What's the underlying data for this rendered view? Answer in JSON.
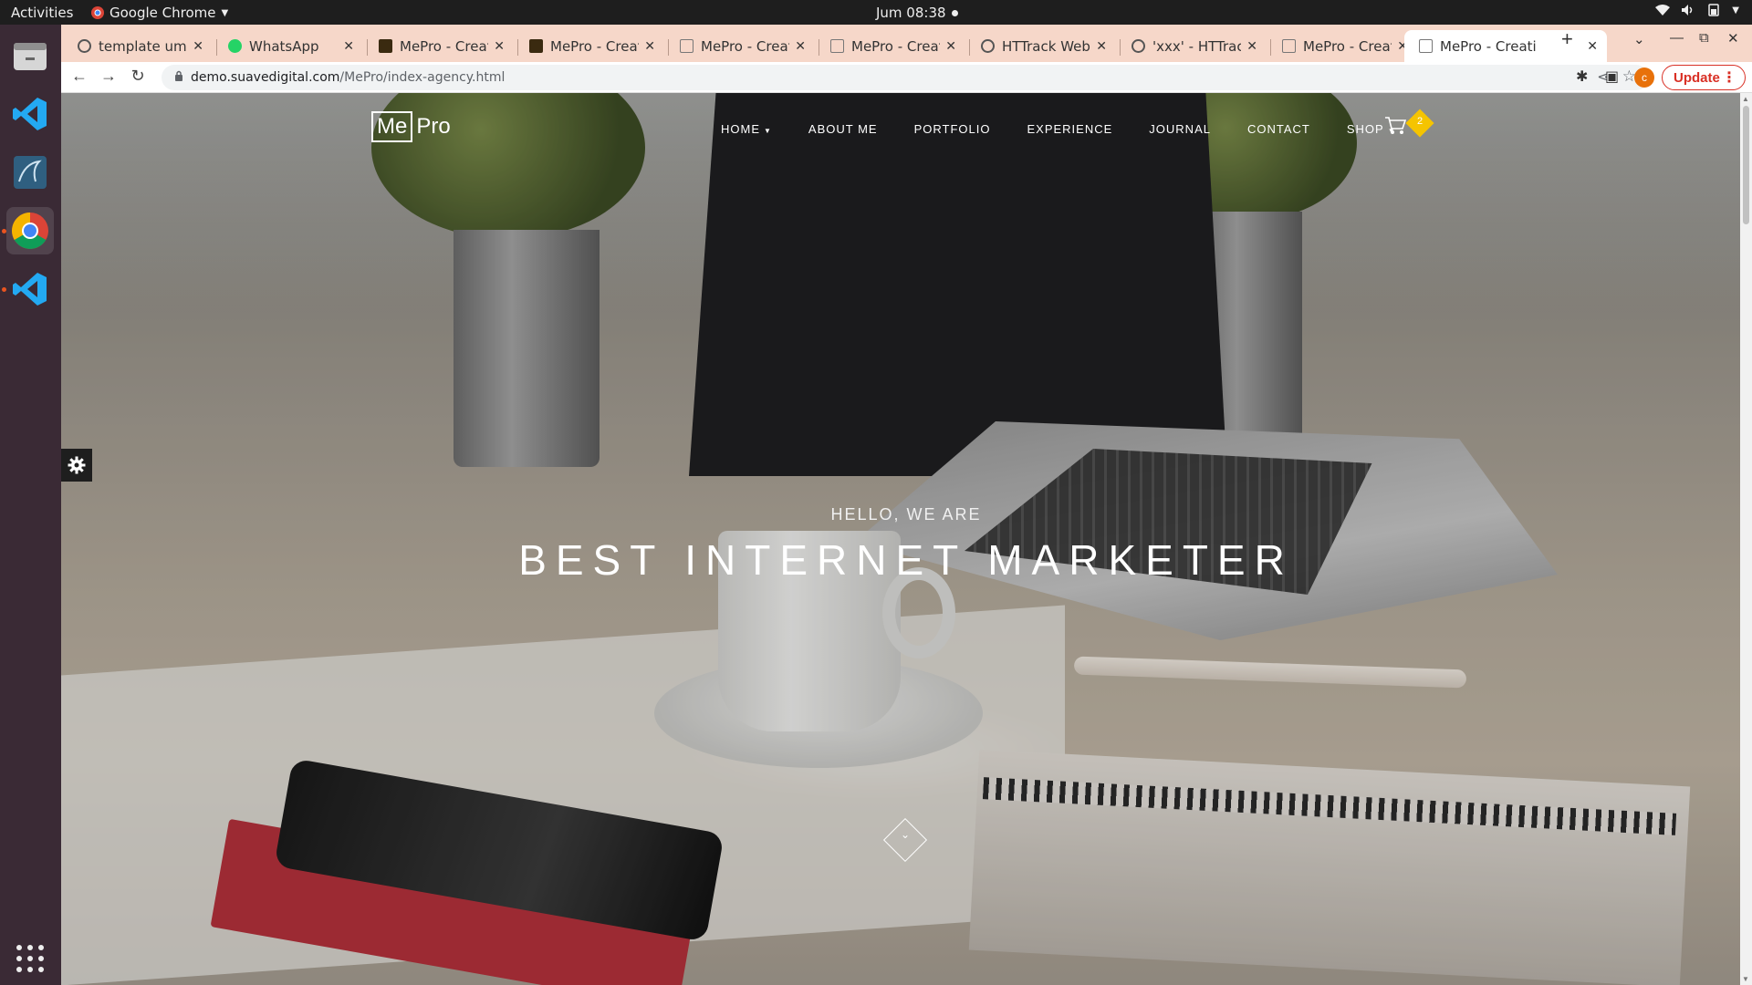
{
  "system": {
    "activities": "Activities",
    "app_name": "Google Chrome",
    "clock": "Jum 08:38"
  },
  "browser": {
    "tabs": [
      {
        "title": "template umk",
        "active": false
      },
      {
        "title": "WhatsApp",
        "active": false
      },
      {
        "title": "MePro - Creati",
        "active": false
      },
      {
        "title": "MePro - Creati",
        "active": false
      },
      {
        "title": "MePro - Creati",
        "active": false
      },
      {
        "title": "MePro - Creati",
        "active": false
      },
      {
        "title": "HTTrack Webs",
        "active": false
      },
      {
        "title": "'xxx' - HTTrack",
        "active": false
      },
      {
        "title": "MePro - Creati",
        "active": false
      },
      {
        "title": "MePro - Creati",
        "active": true
      }
    ],
    "address": {
      "domain": "demo.suavedigital.com",
      "path": "/MePro/index-agency.html"
    },
    "profile_initial": "c",
    "update_label": "Update"
  },
  "site": {
    "logo_me": "Me",
    "logo_pro": "Pro",
    "nav": {
      "home": "HOME",
      "about": "ABOUT ME",
      "portfolio": "PORTFOLIO",
      "experience": "EXPERIENCE",
      "journal": "JOURNAL",
      "contact": "CONTACT",
      "shop": "SHOP"
    },
    "cart_count": "2",
    "hero_sub": "HELLO, WE ARE",
    "hero_title": "BEST INTERNET MARKETER"
  },
  "colors": {
    "accent_badge": "#f5c400",
    "tabstrip": "#f6d7c9",
    "update": "#d93025",
    "dock": "#3a2a35"
  }
}
